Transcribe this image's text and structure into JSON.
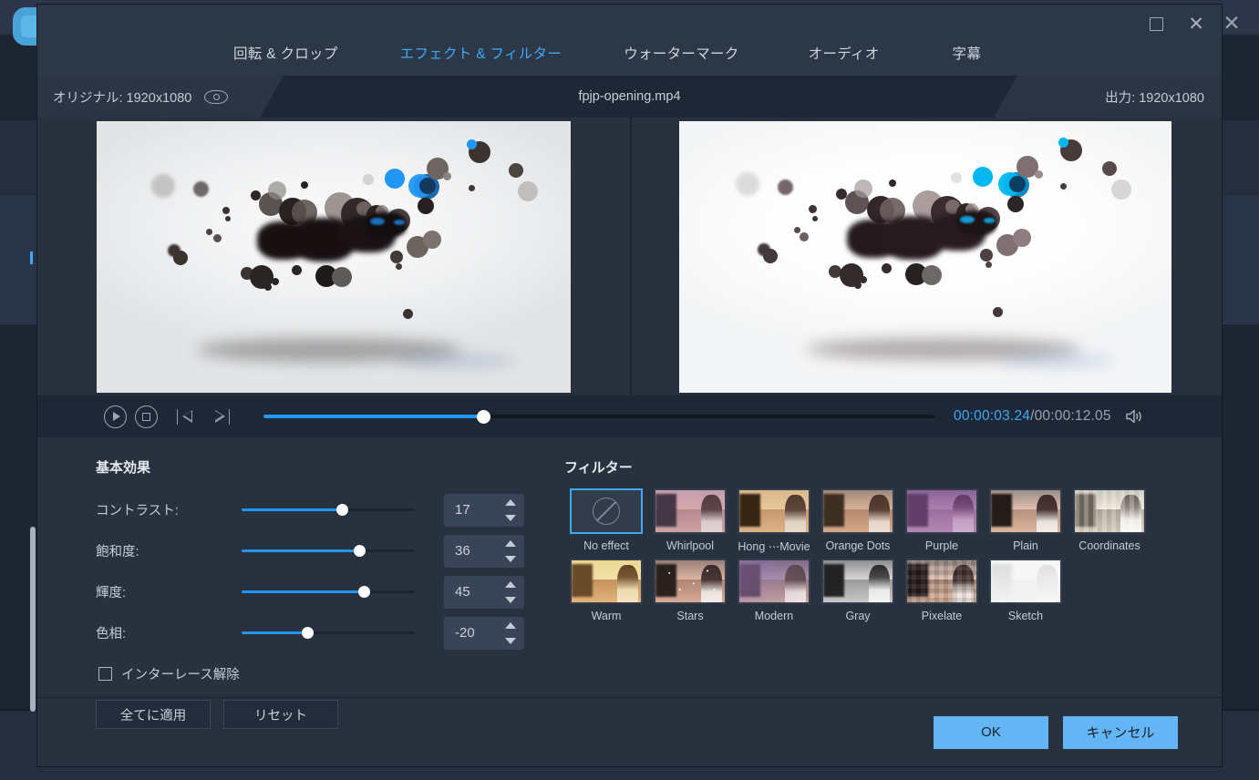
{
  "background_app": {
    "close_icon": "✕"
  },
  "dialog": {
    "window_controls": {
      "maximize": "maximize-icon",
      "close": "close-icon"
    },
    "tabs": [
      {
        "label": "回転 & クロップ",
        "active": false
      },
      {
        "label": "エフェクト & フィルター",
        "active": true
      },
      {
        "label": "ウォーターマーク",
        "active": false
      },
      {
        "label": "オーディオ",
        "active": false
      },
      {
        "label": "字幕",
        "active": false
      }
    ],
    "info_bar": {
      "original_label": "オリジナル: 1920x1080",
      "eye_icon": "eye-icon",
      "filename": "fpjp-opening.mp4",
      "output_label": "出力: 1920x1080"
    },
    "transport": {
      "play_icon": "play-icon",
      "stop_icon": "stop-icon",
      "prev_frame_icon": "previous-frame-icon",
      "next_frame_icon": "next-frame-icon",
      "seek_percent": 33,
      "current_time": "00:00:03.24",
      "total_time": "/00:00:12.05",
      "volume_icon": "volume-icon"
    },
    "basic_effects": {
      "title": "基本効果",
      "rows": [
        {
          "label": "コントラスト:",
          "value": "17",
          "percent": 58
        },
        {
          "label": "飽和度:",
          "value": "36",
          "percent": 68
        },
        {
          "label": "輝度:",
          "value": "45",
          "percent": 71
        },
        {
          "label": "色相:",
          "value": "-20",
          "percent": 38
        }
      ],
      "deinterlace_label": "インターレース解除",
      "deinterlace_checked": false,
      "apply_all_label": "全てに適用",
      "reset_label": "リセット"
    },
    "filters": {
      "title": "フィルター",
      "items": [
        {
          "label": "No effect",
          "selected": true
        },
        {
          "label": "Whirlpool",
          "selected": false
        },
        {
          "label": "Hong ⋯Movie",
          "selected": false
        },
        {
          "label": "Orange Dots",
          "selected": false
        },
        {
          "label": "Purple",
          "selected": false
        },
        {
          "label": "Plain",
          "selected": false
        },
        {
          "label": "Coordinates",
          "selected": false
        },
        {
          "label": "Warm",
          "selected": false
        },
        {
          "label": "Stars",
          "selected": false
        },
        {
          "label": "Modern",
          "selected": false
        },
        {
          "label": "Gray",
          "selected": false
        },
        {
          "label": "Pixelate",
          "selected": false
        },
        {
          "label": "Sketch",
          "selected": false
        }
      ]
    },
    "footer": {
      "ok_label": "OK",
      "cancel_label": "キャンセル"
    }
  },
  "colors": {
    "accent": "#3fa9f5",
    "slider": "#2196f3",
    "primary_button": "#64b5f6",
    "dialog_bg": "#28323f",
    "panel_bg": "#1e2735"
  }
}
